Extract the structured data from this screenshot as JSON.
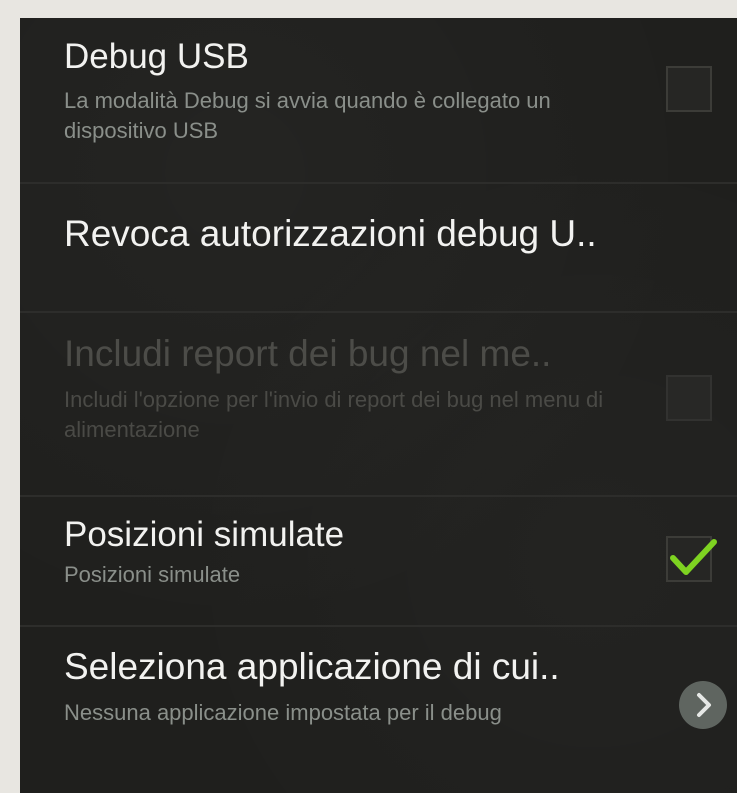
{
  "settings": [
    {
      "title": "Debug USB",
      "summary": "La modalità Debug si avvia quando è collegato un dispositivo USB",
      "checked": false,
      "enabled": true,
      "widget": "checkbox"
    },
    {
      "title": "Revoca autorizzazioni debug U..",
      "enabled": true,
      "widget": "none"
    },
    {
      "title": "Includi report dei bug nel me..",
      "summary": "Includi l'opzione per l'invio di report dei bug nel menu di alimentazione",
      "checked": false,
      "enabled": false,
      "widget": "checkbox"
    },
    {
      "title": "Posizioni simulate",
      "summary": "Posizioni simulate",
      "checked": true,
      "enabled": true,
      "widget": "checkbox"
    },
    {
      "title": "Seleziona applicazione di cui..",
      "summary": "Nessuna applicazione impostata per il debug",
      "enabled": true,
      "widget": "chevron"
    }
  ],
  "icons": {
    "checkmark": "check-icon",
    "chevron": "chevron-right-icon"
  },
  "colors": {
    "background": "#1f1f1d",
    "title": "#f2f2f0",
    "summary": "#8a8f8a",
    "disabled": "#4c4c48",
    "check_accent": "#7ed321",
    "chevron_bg": "#5f6560"
  }
}
